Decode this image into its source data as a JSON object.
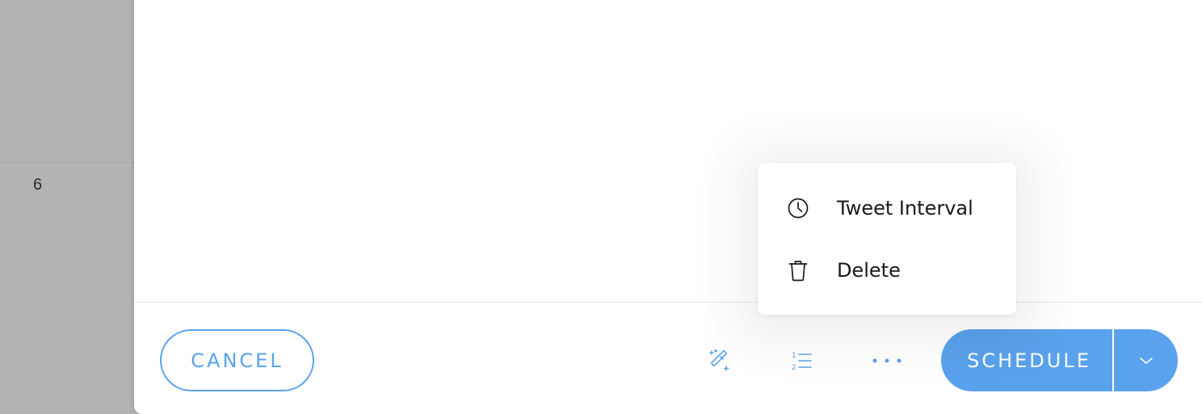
{
  "calendar": {
    "day_number": "6"
  },
  "footer": {
    "cancel_label": "CANCEL",
    "schedule_label": "SCHEDULE",
    "icons": {
      "magic_wand": "magic-wand-icon",
      "numbered_list": "numbered-list-icon",
      "more": "more-horizontal-icon",
      "chevron": "chevron-down-icon"
    }
  },
  "menu": {
    "items": [
      {
        "label": "Tweet Interval",
        "icon": "clock-icon"
      },
      {
        "label": "Delete",
        "icon": "trash-icon"
      }
    ]
  },
  "colors": {
    "accent": "#5aa2ec",
    "overlay": "#b3b3b3",
    "panel": "#ffffff"
  }
}
